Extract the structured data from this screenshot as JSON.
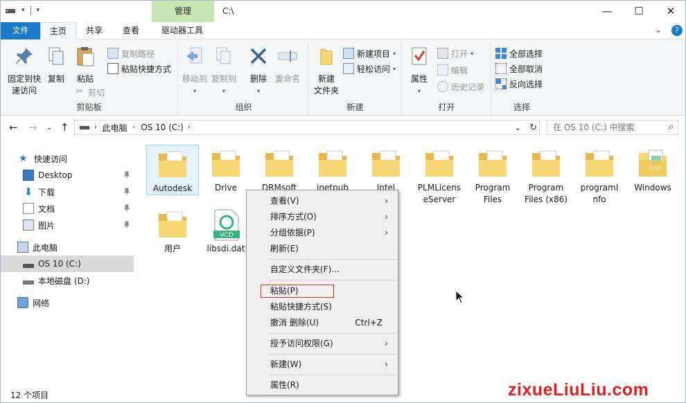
{
  "titlebar": {
    "manage_tab": "管理",
    "path": "C:\\",
    "minimize": "—",
    "maximize": "☐",
    "close": "✕"
  },
  "ribbon_tabs": {
    "file": "文件",
    "home": "主页",
    "share": "共享",
    "view": "查看",
    "drive_tools": "驱动器工具"
  },
  "ribbon": {
    "clipboard": {
      "pin_label": "固定到快\n速访问",
      "copy_label": "复制",
      "paste_label": "粘贴",
      "copy_path": "复制路径",
      "paste_shortcut": "粘贴快捷方式",
      "cut": "剪切",
      "group": "剪贴板"
    },
    "organize": {
      "move_to": "移动到",
      "copy_to": "复制到",
      "delete": "删除",
      "rename": "重命名",
      "group": "组织"
    },
    "new": {
      "new_folder": "新建\n文件夹",
      "new_item": "新建项目",
      "easy_access": "轻松访问",
      "group": "新建"
    },
    "open": {
      "properties": "属性",
      "open": "打开",
      "edit": "编辑",
      "history": "历史记录",
      "group": "打开"
    },
    "select": {
      "select_all": "全部选择",
      "select_none": "全部取消",
      "invert": "反向选择",
      "group": "选择"
    }
  },
  "address": {
    "this_pc": "此电脑",
    "drive": "OS 10 (C:)",
    "search_placeholder": "在 OS 10 (C:) 中搜索"
  },
  "nav": {
    "quick_access": "快速访问",
    "desktop": "Desktop",
    "downloads": "下载",
    "documents": "文档",
    "pictures": "图片",
    "this_pc": "此电脑",
    "os_drive": "OS 10 (C:)",
    "local_disk": "本地磁盘 (D:)",
    "network": "网络"
  },
  "files": [
    {
      "name": "Autodesk"
    },
    {
      "name": "Drive"
    },
    {
      "name": "DRMsoft"
    },
    {
      "name": "inetpub"
    },
    {
      "name": "Intel"
    },
    {
      "name": "PLMLicens\neServer"
    },
    {
      "name": "Program\nFiles"
    },
    {
      "name": "Program\nFiles (x86)"
    },
    {
      "name": "programI\nnfo"
    },
    {
      "name": "Windows"
    },
    {
      "name": "用户"
    },
    {
      "name": "libsdi.dat"
    }
  ],
  "vcd_label": "VCD",
  "context_menu": {
    "view": "查看(V)",
    "sort": "排序方式(O)",
    "group": "分组依据(P)",
    "refresh": "刷新(E)",
    "customize": "自定义文件夹(F)...",
    "paste": "粘贴(P)",
    "paste_shortcut": "粘贴快捷方式(S)",
    "undo": "撤消 删除(U)",
    "undo_shortcut": "Ctrl+Z",
    "grant": "授予访问权限(G)",
    "new": "新建(W)",
    "properties": "属性(R)"
  },
  "status": {
    "count": "12 个项目"
  },
  "watermark": "zixueLiuLiu.com",
  "colors": {
    "accent": "#1979ca",
    "manage_tab": "#c6e7b4",
    "folder": "#f8d775",
    "highlight_box": "#d03030",
    "watermark": "#e02020"
  }
}
